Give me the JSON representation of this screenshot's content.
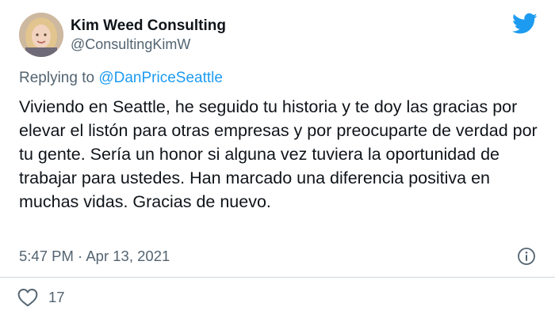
{
  "author": {
    "display_name": "Kim Weed Consulting",
    "handle": "@ConsultingKimW",
    "avatar_icon": "profile-photo"
  },
  "reply": {
    "prefix": "Replying to",
    "mention": "@DanPriceSeattle"
  },
  "tweet": {
    "text": "Viviendo en Seattle, he seguido tu historia y te doy las gracias por elevar el listón para otras empresas y por preocuparte de verdad por tu gente. Sería un honor si alguna vez tuviera la oportunidad de trabajar para ustedes. Han marcado una diferencia positiva en muchas vidas. Gracias de nuevo.",
    "time": "5:47 PM",
    "separator": "·",
    "date": "Apr 13, 2021"
  },
  "actions": {
    "likes": "17"
  },
  "colors": {
    "brand_blue": "#1d9bf0",
    "muted_text": "#536471",
    "text": "#0f1419",
    "divider": "#cfd9de"
  },
  "icons": [
    "twitter-bird-icon",
    "info-icon",
    "heart-icon"
  ]
}
